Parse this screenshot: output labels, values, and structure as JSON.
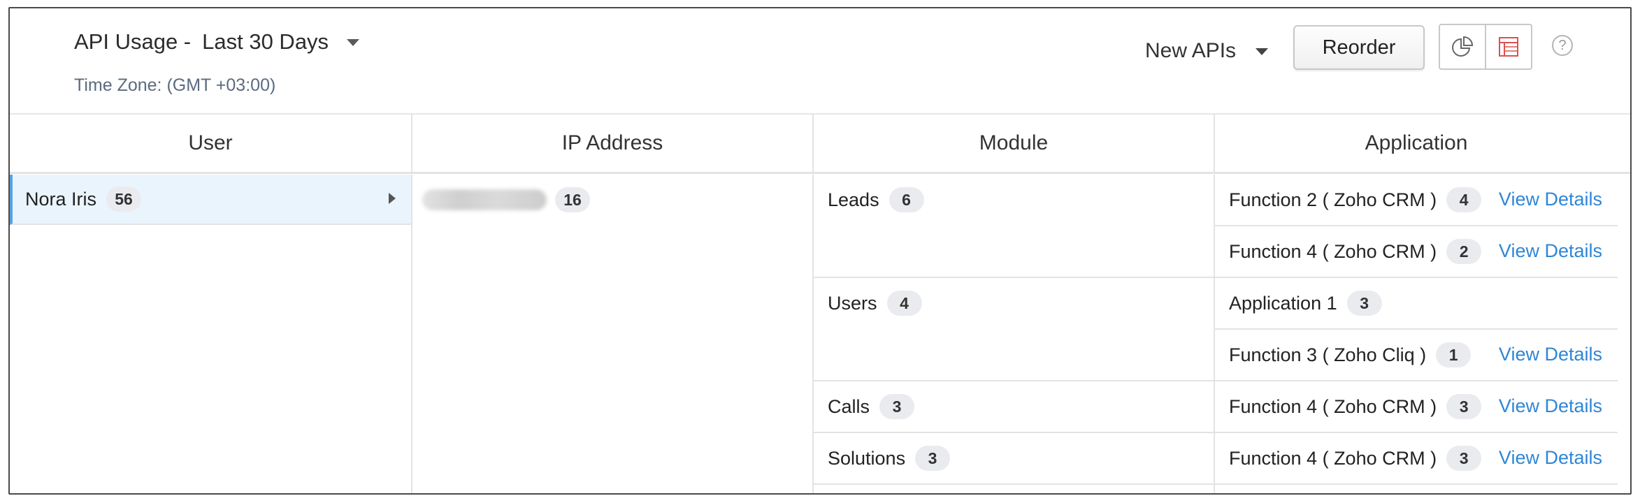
{
  "header": {
    "title": "API Usage -",
    "period": "Last 30 Days",
    "timezone": "Time Zone: (GMT +03:00)",
    "api_filter": "New APIs",
    "reorder_label": "Reorder",
    "help": "?"
  },
  "colors": {
    "link": "#2f86d6",
    "selected_row": "#eaf4fd",
    "accent": "#5aa2e0"
  },
  "table": {
    "columns": [
      "User",
      "IP Address",
      "Module",
      "Application"
    ],
    "user": {
      "name": "Nora Iris",
      "count": "56"
    },
    "ip": {
      "count": "16"
    },
    "modules": [
      {
        "name": "Leads",
        "count": "6"
      },
      {
        "name": "Users",
        "count": "4"
      },
      {
        "name": "Calls",
        "count": "3"
      },
      {
        "name": "Solutions",
        "count": "3"
      }
    ],
    "applications": [
      {
        "name": "Function 2 ( Zoho CRM )",
        "count": "4",
        "link": "View Details"
      },
      {
        "name": "Function 4 ( Zoho CRM )",
        "count": "2",
        "link": "View Details"
      },
      {
        "name": "Application 1",
        "count": "3",
        "link": ""
      },
      {
        "name": "Function 3 ( Zoho Cliq )",
        "count": "1",
        "link": "View Details"
      },
      {
        "name": "Function 4 ( Zoho CRM )",
        "count": "3",
        "link": "View Details"
      },
      {
        "name": "Function 4 ( Zoho CRM )",
        "count": "3",
        "link": "View Details"
      }
    ]
  }
}
